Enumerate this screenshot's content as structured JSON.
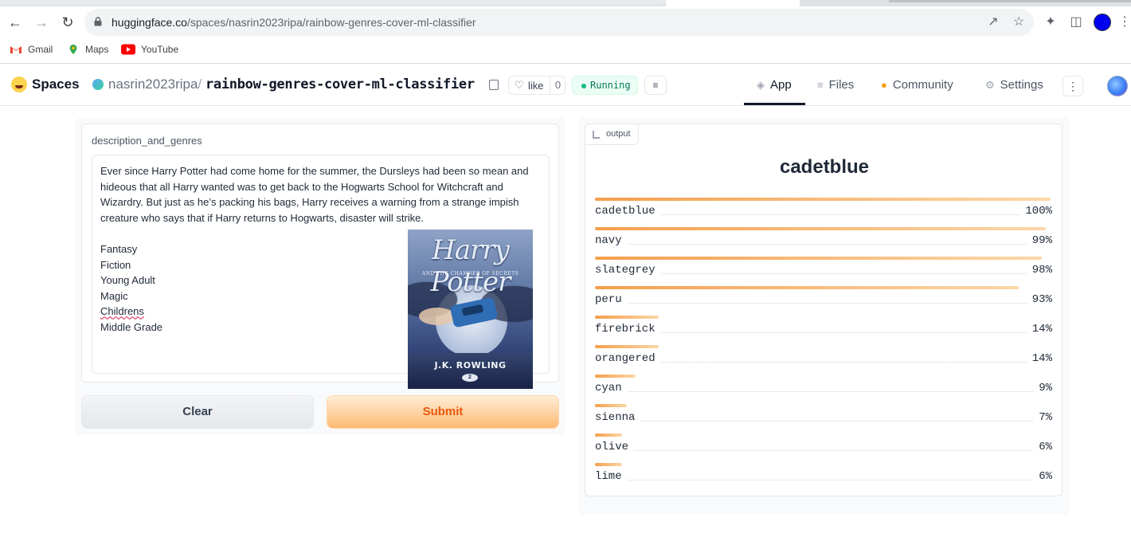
{
  "browser": {
    "url_host": "huggingface.co",
    "url_path": "/spaces/nasrin2023ripa/rainbow-genres-cover-ml-classifier",
    "bookmarks": [
      {
        "label": "Gmail"
      },
      {
        "label": "Maps"
      },
      {
        "label": "YouTube"
      }
    ],
    "profile_color": "#0000ee"
  },
  "header": {
    "spaces_label": "Spaces",
    "owner": "nasrin2023ripa",
    "separator": "/",
    "repo": "rainbow-genres-cover-ml-classifier",
    "like_label": "like",
    "like_count": "0",
    "status": "Running",
    "nav": [
      {
        "label": "App",
        "icon": "cube-icon",
        "active": true
      },
      {
        "label": "Files",
        "icon": "files-icon"
      },
      {
        "label": "Community",
        "icon": "community-icon"
      },
      {
        "label": "Settings",
        "icon": "gear-icon"
      }
    ]
  },
  "input": {
    "label": "description_and_genres",
    "description": "Ever since Harry Potter had come home for the summer, the Dursleys had been so mean and hideous that all Harry wanted was to get back to the Hogwarts School for Witchcraft and Wizardry. But just as he’s packing his bags, Harry receives a warning from a strange impish creature who says that if Harry returns to Hogwarts, disaster will strike.",
    "genres": [
      "Fantasy",
      "Fiction",
      "Young Adult",
      "Magic",
      "Childrens",
      "Middle Grade"
    ],
    "clear_label": "Clear",
    "submit_label": "Submit"
  },
  "cover": {
    "title": "Harry Potter",
    "subtitle": "AND THE CHAMBER OF SECRETS",
    "author": "J.K. ROWLING",
    "number": "2"
  },
  "output": {
    "tag": "output",
    "top_label": "cadetblue",
    "confidences": [
      {
        "label": "cadetblue",
        "value": 1.0,
        "display": "100%"
      },
      {
        "label": "navy",
        "value": 0.99,
        "display": "99%"
      },
      {
        "label": "slategrey",
        "value": 0.98,
        "display": "98%"
      },
      {
        "label": "peru",
        "value": 0.93,
        "display": "93%"
      },
      {
        "label": "firebrick",
        "value": 0.14,
        "display": "14%"
      },
      {
        "label": "orangered",
        "value": 0.14,
        "display": "14%"
      },
      {
        "label": "cyan",
        "value": 0.09,
        "display": "9%"
      },
      {
        "label": "sienna",
        "value": 0.07,
        "display": "7%"
      },
      {
        "label": "olive",
        "value": 0.06,
        "display": "6%"
      },
      {
        "label": "lime",
        "value": 0.06,
        "display": "6%"
      }
    ]
  },
  "colors": {
    "accent": "#f97316",
    "running": "#047857",
    "bar_start": "#f59e4c",
    "bar_end": "#fbd7a8"
  }
}
